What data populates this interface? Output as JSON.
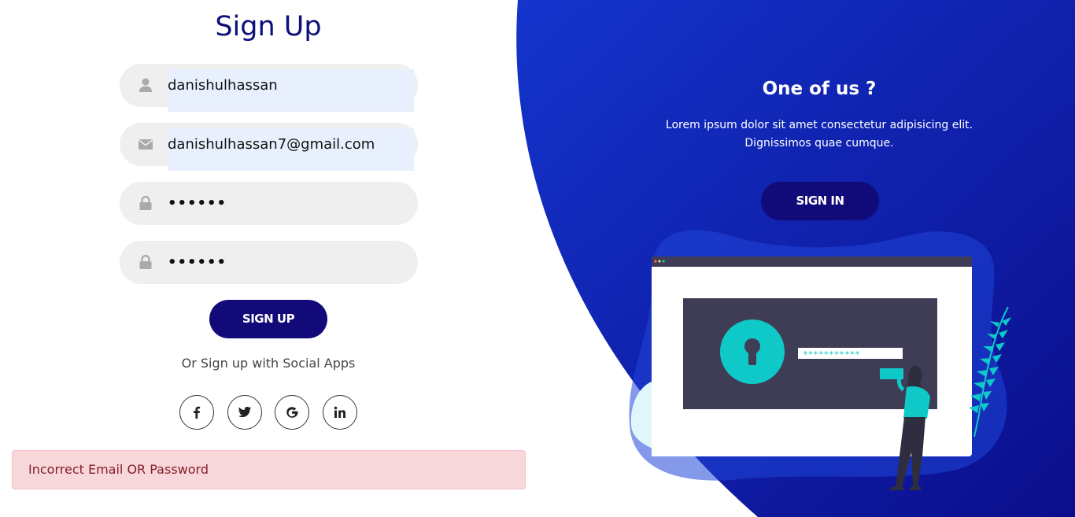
{
  "signup": {
    "title": "Sign Up",
    "username_value": "danishulhassan",
    "email_value": "danishulhassan7@gmail.com",
    "password_value": "••••••",
    "confirm_password_value": "••••••",
    "submit_label": "SIGN UP",
    "social_text": "Or Sign up with Social Apps",
    "social_buttons": [
      {
        "icon": "facebook-icon",
        "glyph": "f"
      },
      {
        "icon": "twitter-icon",
        "glyph": "t"
      },
      {
        "icon": "google-icon",
        "glyph": "G"
      },
      {
        "icon": "linkedin-icon",
        "glyph": "in"
      }
    ]
  },
  "alert": {
    "message": "Incorrect Email OR Password",
    "type": "danger"
  },
  "panel": {
    "title": "One of us ?",
    "text_line1": "Lorem ipsum dolor sit amet consectetur adipisicing elit.",
    "text_line2": "Dignissimos quae cumque.",
    "signin_label": "SIGN IN",
    "illustration_password_mask": "***********"
  },
  "colors": {
    "title": "#0d0f7a",
    "button": "#120a78",
    "panel_gradient_start": "#1231c8",
    "panel_gradient_end": "#0c0f93",
    "accent_teal": "#0fc8c8",
    "alert_bg": "#f8d7da",
    "alert_text": "#842029",
    "field_bg": "#efefef",
    "autofill_bg": "#e8f0fe"
  }
}
